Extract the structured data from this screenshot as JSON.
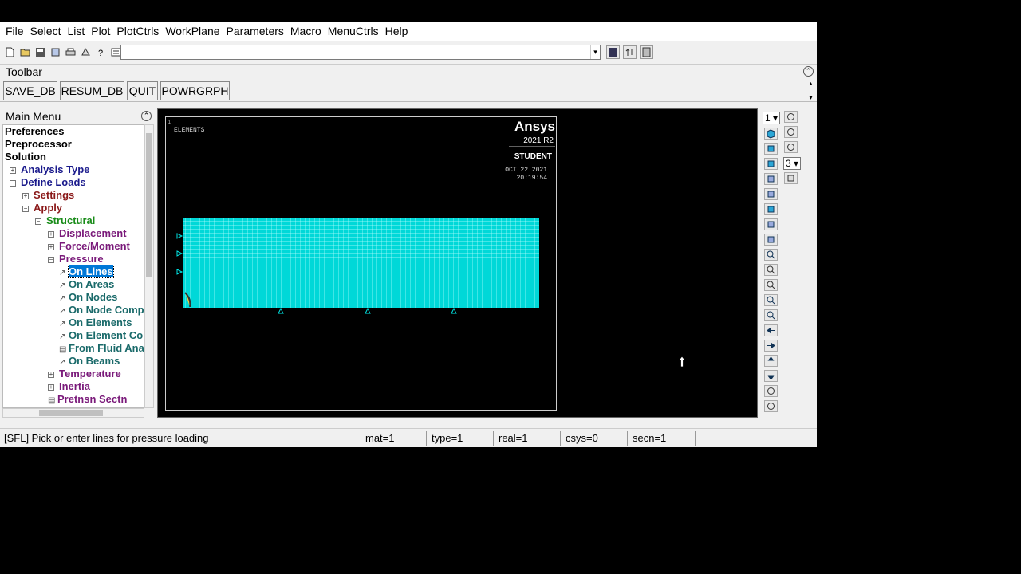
{
  "menubar": [
    "File",
    "Select",
    "List",
    "Plot",
    "PlotCtrls",
    "WorkPlane",
    "Parameters",
    "Macro",
    "MenuCtrls",
    "Help"
  ],
  "toolbar": {
    "label": "Toolbar",
    "buttons": [
      "SAVE_DB",
      "RESUM_DB",
      "QUIT",
      "POWRGRPH"
    ]
  },
  "main_menu": {
    "title": "Main Menu",
    "items": [
      {
        "label": "Preferences",
        "color": "#000000"
      },
      {
        "label": "Preprocessor",
        "color": "#000000"
      },
      {
        "label": "Solution",
        "color": "#000000"
      },
      {
        "label": "Analysis Type",
        "color": "#1a1a8c"
      },
      {
        "label": "Define Loads",
        "color": "#1a1a8c"
      },
      {
        "label": "Settings",
        "color": "#8b1a1a"
      },
      {
        "label": "Apply",
        "color": "#8b1a1a"
      },
      {
        "label": "Structural",
        "color": "#1a8c1a"
      },
      {
        "label": "Displacement",
        "color": "#7a1a7a"
      },
      {
        "label": "Force/Moment",
        "color": "#7a1a7a"
      },
      {
        "label": "Pressure",
        "color": "#7a1a7a"
      },
      {
        "label": "On Lines",
        "color": "#1a6a6a"
      },
      {
        "label": "On Areas",
        "color": "#1a6a6a"
      },
      {
        "label": "On Nodes",
        "color": "#1a6a6a"
      },
      {
        "label": "On Node Comp",
        "color": "#1a6a6a"
      },
      {
        "label": "On Elements",
        "color": "#1a6a6a"
      },
      {
        "label": "On Element Co",
        "color": "#1a6a6a"
      },
      {
        "label": "From Fluid Ana",
        "color": "#1a6a6a"
      },
      {
        "label": "On Beams",
        "color": "#1a6a6a"
      },
      {
        "label": "Temperature",
        "color": "#7a1a7a"
      },
      {
        "label": "Inertia",
        "color": "#7a1a7a"
      },
      {
        "label": "Pretnsn Sectn",
        "color": "#7a1a7a"
      }
    ]
  },
  "graphics": {
    "window_number": "1",
    "plot_label": "ELEMENTS",
    "brand": "Ansys",
    "version": "2021 R2",
    "edition": "STUDENT",
    "date": "OCT 22 2021",
    "time": "20:19:54",
    "mesh_color": "#00e5e5"
  },
  "right_tools": {
    "window_select": "1",
    "view_select": "3"
  },
  "status": {
    "prompt": "[SFL]  Pick or enter lines for pressure loading",
    "mat": "mat=1",
    "type": "type=1",
    "real": "real=1",
    "csys": "csys=0",
    "secn": "secn=1"
  }
}
